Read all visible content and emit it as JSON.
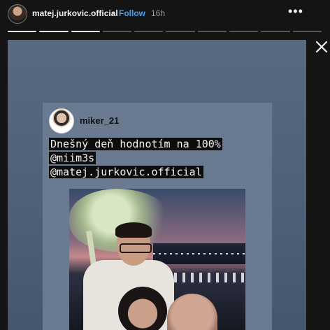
{
  "header": {
    "username": "matej.jurkovic.official",
    "separator": "•",
    "follow_label": "Follow",
    "time_ago": "16h",
    "more_label": "•••"
  },
  "progress": {
    "total_segments": 10,
    "completed_segments": 3
  },
  "story": {
    "shared_post": {
      "username": "miker_21",
      "caption_lines": [
        "Dnešný deň hodnotím na 100%",
        "@miim3s",
        "@matej.jurkovic.official"
      ]
    }
  },
  "icons": {
    "close": "close-icon",
    "more": "more-options-icon",
    "avatar": "avatar"
  }
}
